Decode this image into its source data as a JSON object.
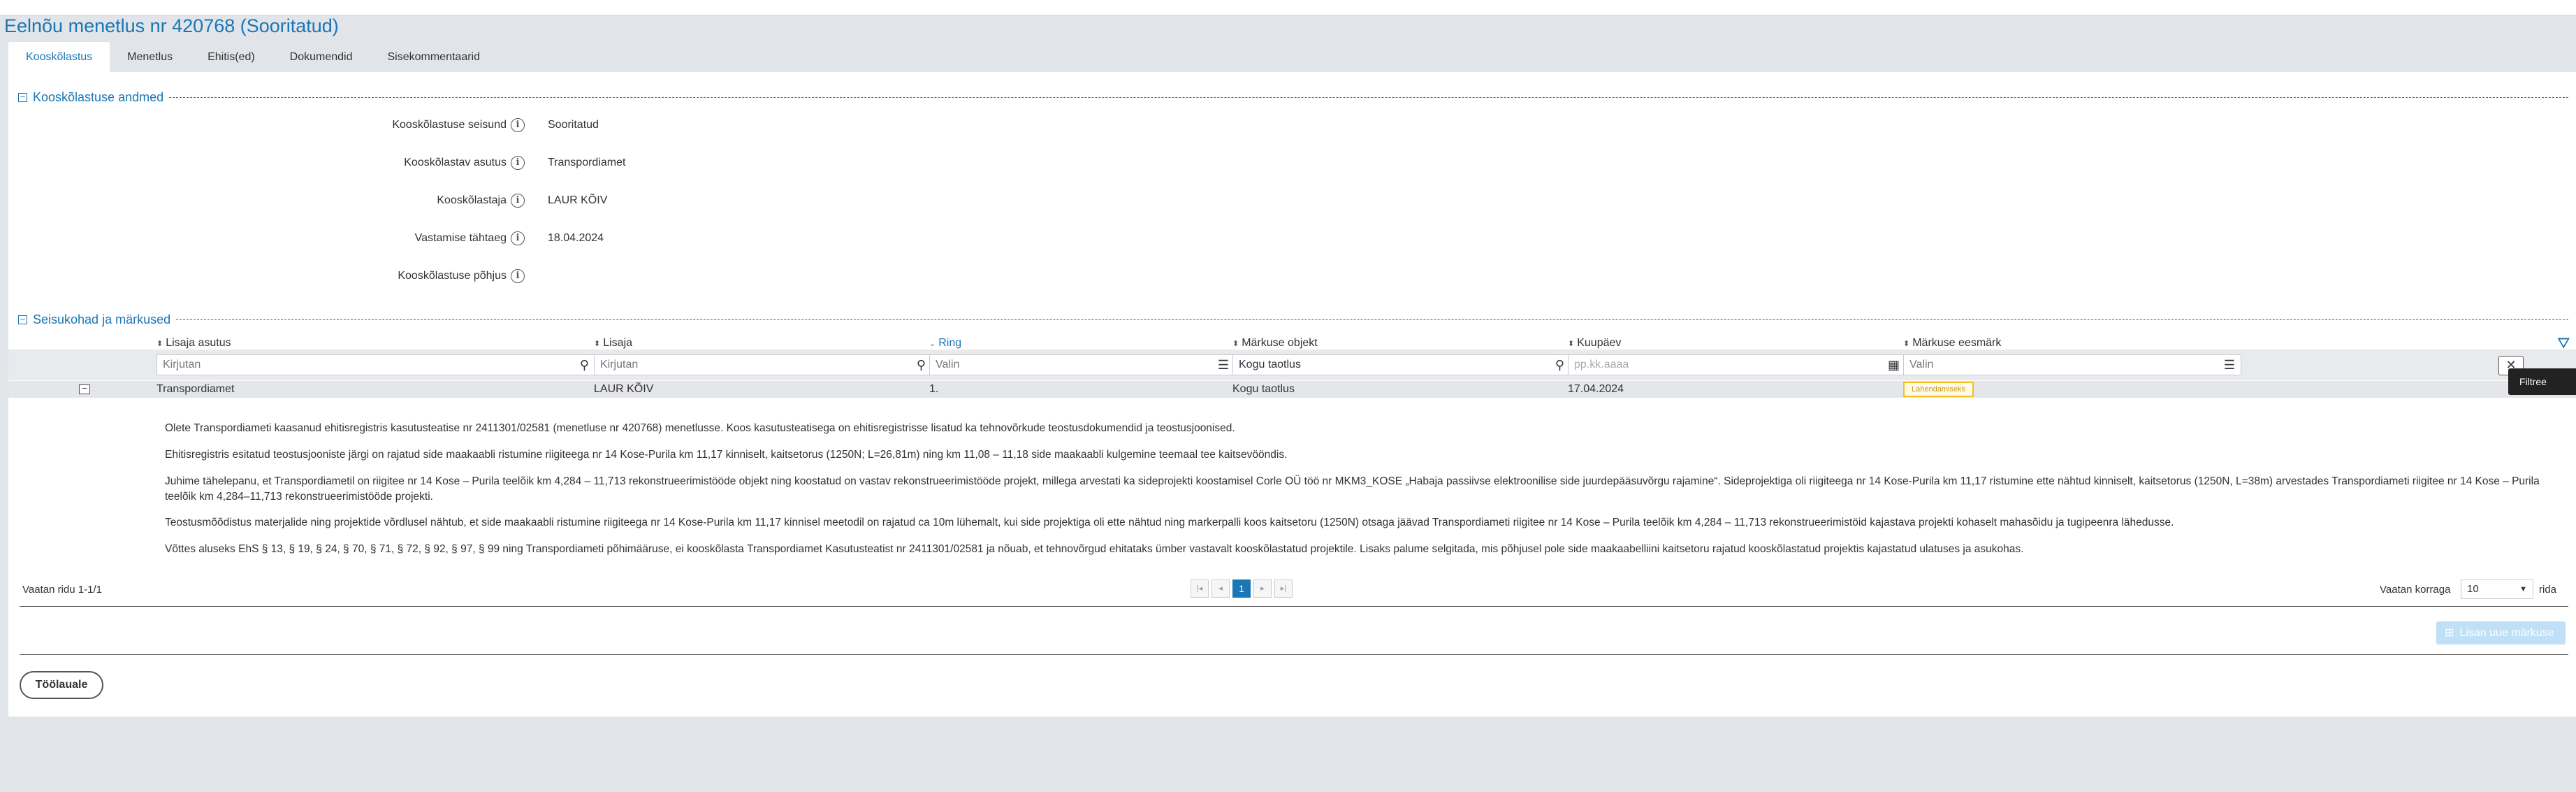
{
  "page": {
    "title": "Eelnõu menetlus nr 420768 (Sooritatud)"
  },
  "tabs": [
    "Kooskõlastus",
    "Menetlus",
    "Ehitis(ed)",
    "Dokumendid",
    "Sisekommentaarid"
  ],
  "section1": {
    "title": "Kooskõlastuse andmed",
    "fields": [
      {
        "label": "Kooskõlastuse seisund",
        "value": "Sooritatud"
      },
      {
        "label": "Kooskõlastav asutus",
        "value": "Transpordiamet"
      },
      {
        "label": "Kooskõlastaja",
        "value": "LAUR KÕIV"
      },
      {
        "label": "Vastamise tähtaeg",
        "value": "18.04.2024"
      },
      {
        "label": "Kooskõlastuse põhjus",
        "value": ""
      }
    ]
  },
  "section2": {
    "title": "Seisukohad ja märkused"
  },
  "table": {
    "columns": [
      "Lisaja asutus",
      "Lisaja",
      "Ring",
      "Märkuse objekt",
      "Kuupäev",
      "Märkuse eesmärk"
    ],
    "filters": [
      "Kirjutan",
      "Kirjutan",
      "Valin",
      "Kogu taotlus",
      "pp.kk.aaaa",
      "Valin"
    ],
    "row": {
      "asutus": "Transpordiamet",
      "lisaja": "LAUR KÕIV",
      "ring": "1.",
      "objekt": "Kogu taotlus",
      "kuupaev": "17.04.2024",
      "eesmark": "Lahendamiseks"
    },
    "paragraphs": [
      "Olete Transpordiameti kaasanud ehitisregistris kasutusteatise nr 2411301/02581 (menetluse nr 420768) menetlusse. Koos kasutusteatisega on ehitisregistrisse lisatud ka tehnovõrkude teostusdokumendid ja teostusjoonised.",
      "Ehitisregistris esitatud teostusjooniste järgi on rajatud side maakaabli ristumine riigiteega nr 14 Kose-Purila km 11,17 kinniselt, kaitsetorus (1250N; L=26,81m) ning km 11,08 – 11,18 side maakaabli kulgemine teemaal tee kaitsevööndis.",
      "Juhime tähelepanu, et Transpordiametil on riigitee nr 14 Kose – Purila teelõik km 4,284 – 11,713 rekonstrueerimistööde objekt ning koostatud on vastav rekonstrueerimistööde projekt, millega arvestati ka sideprojekti koostamisel Corle OÜ töö nr MKM3_KOSE „Habaja passiivse elektroonilise side juurdepääsuvõrgu rajamine“. Sideprojektiga oli riigiteega nr 14 Kose-Purila km 11,17 ristumine ette nähtud kinniselt, kaitsetorus (1250N, L=38m) arvestades Transpordiameti riigitee nr 14 Kose – Purila teelõik km 4,284–11,713 rekonstrueerimistööde projekti.",
      "Teostusmõõdistus materjalide ning projektide võrdlusel nähtub, et side maakaabli ristumine riigiteega nr 14 Kose-Purila km 11,17 kinnisel meetodil on rajatud ca 10m lühemalt, kui side projektiga oli ette nähtud ning markerpalli koos kaitsetoru (1250N) otsaga jäävad Transpordiameti riigitee nr 14 Kose – Purila teelõik km 4,284 – 11,713 rekonstrueerimistöid kajastava projekti kohaselt mahasõidu ja tugipeenra lähedusse.",
      "Võttes aluseks EhS § 13, § 19, § 24, § 70, § 71, § 72, § 92, § 97, § 99 ning Transpordiameti põhimääruse, ei kooskõlasta Transpordiamet Kasutusteatist nr 2411301/02581 ja nõuab, et tehnovõrgud ehitataks ümber vastavalt kooskõlastatud projektile. Lisaks palume selgitada, mis põhjusel pole side maakaabelliini kaitsetoru rajatud kooskõlastatud projektis kajastatud ulatuses ja asukohas."
    ]
  },
  "pagination": {
    "summary": "Vaatan ridu 1-1/1",
    "current_page": "1",
    "per_page_label": "Vaatan korraga",
    "per_page_value": "10",
    "per_page_suffix": "rida"
  },
  "buttons": {
    "add_remark": "Lisan uue märkuse",
    "back": "Töölauale",
    "tooltip": "Filtree"
  }
}
